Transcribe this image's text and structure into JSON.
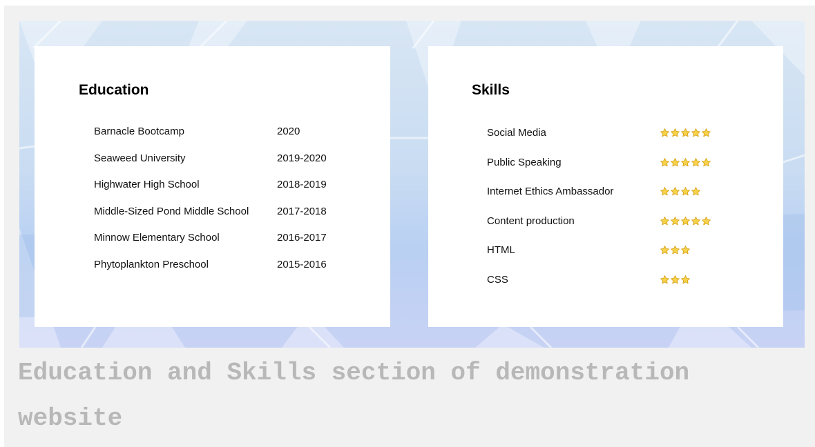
{
  "education": {
    "title": "Education",
    "rows": [
      {
        "school": "Barnacle Bootcamp",
        "years": "2020"
      },
      {
        "school": "Seaweed University",
        "years": "2019-2020"
      },
      {
        "school": "Highwater High School",
        "years": "2018-2019"
      },
      {
        "school": "Middle-Sized Pond Middle School",
        "years": "2017-2018"
      },
      {
        "school": "Minnow Elementary School",
        "years": "2016-2017"
      },
      {
        "school": "Phytoplankton Preschool",
        "years": "2015-2016"
      }
    ]
  },
  "skills": {
    "title": "Skills",
    "rows": [
      {
        "name": "Social Media",
        "stars": 5
      },
      {
        "name": "Public Speaking",
        "stars": 5
      },
      {
        "name": "Internet Ethics Ambassador",
        "stars": 4
      },
      {
        "name": "Content production",
        "stars": 5
      },
      {
        "name": "HTML",
        "stars": 3
      },
      {
        "name": "CSS",
        "stars": 3
      }
    ],
    "star_icon": "star-icon"
  },
  "caption": "Education and Skills section of demonstration website",
  "colors": {
    "star_fill": "#f6d34a",
    "star_stroke": "#d9a21b",
    "caption": "#b8b8b8"
  }
}
